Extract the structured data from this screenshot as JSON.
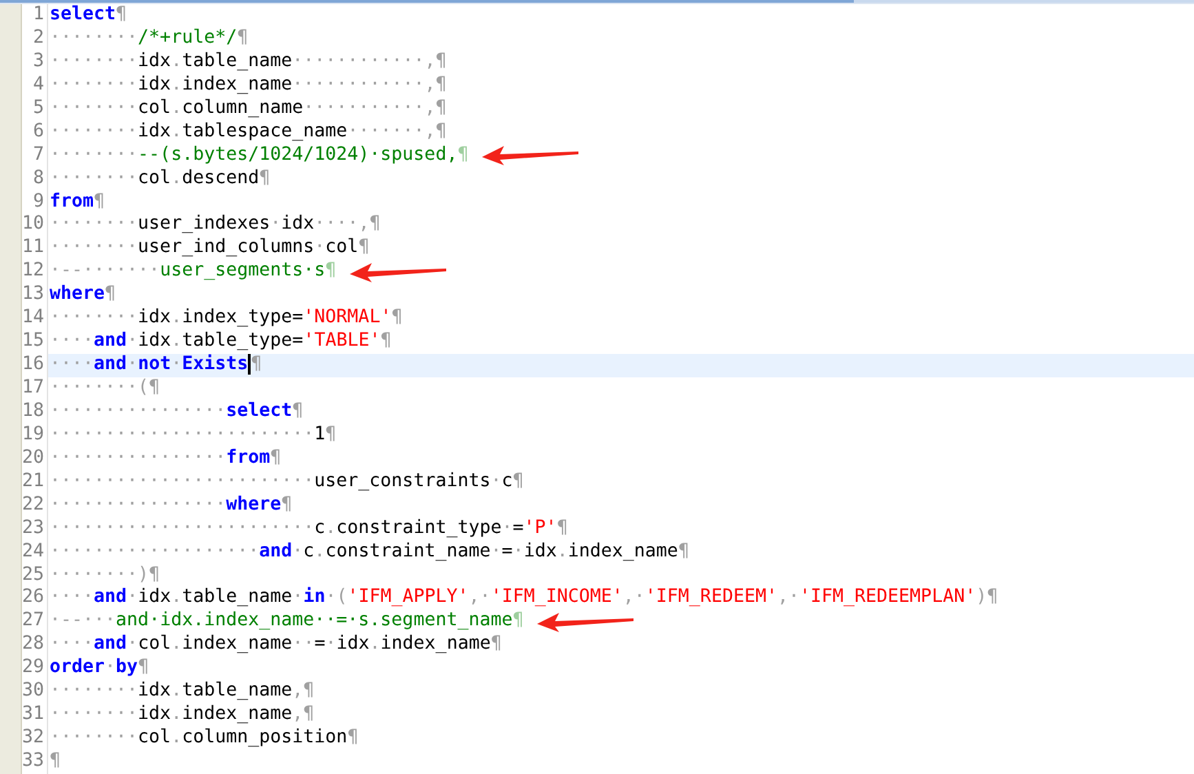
{
  "editor": {
    "lines": [
      {
        "number": "1",
        "current": false,
        "cursor": false,
        "arrow": false,
        "tokens": [
          {
            "kind": "keyword",
            "text": "select"
          },
          {
            "kind": "mark",
            "text": "¶"
          }
        ]
      },
      {
        "number": "2",
        "current": false,
        "cursor": false,
        "arrow": false,
        "tokens": [
          {
            "kind": "mark",
            "text": "········"
          },
          {
            "kind": "comment",
            "text": "/*+rule*/"
          },
          {
            "kind": "mark",
            "text": "¶"
          }
        ]
      },
      {
        "number": "3",
        "current": false,
        "cursor": false,
        "arrow": false,
        "tokens": [
          {
            "kind": "mark",
            "text": "········"
          },
          {
            "kind": "ident",
            "text": "idx"
          },
          {
            "kind": "mark",
            "text": "."
          },
          {
            "kind": "ident",
            "text": "table_name"
          },
          {
            "kind": "mark",
            "text": "············,¶"
          }
        ]
      },
      {
        "number": "4",
        "current": false,
        "cursor": false,
        "arrow": false,
        "tokens": [
          {
            "kind": "mark",
            "text": "········"
          },
          {
            "kind": "ident",
            "text": "idx"
          },
          {
            "kind": "mark",
            "text": "."
          },
          {
            "kind": "ident",
            "text": "index_name"
          },
          {
            "kind": "mark",
            "text": "············,¶"
          }
        ]
      },
      {
        "number": "5",
        "current": false,
        "cursor": false,
        "arrow": false,
        "tokens": [
          {
            "kind": "mark",
            "text": "········"
          },
          {
            "kind": "ident",
            "text": "col"
          },
          {
            "kind": "mark",
            "text": "."
          },
          {
            "kind": "ident",
            "text": "column_name"
          },
          {
            "kind": "mark",
            "text": "···········,¶"
          }
        ]
      },
      {
        "number": "6",
        "current": false,
        "cursor": false,
        "arrow": false,
        "tokens": [
          {
            "kind": "mark",
            "text": "········"
          },
          {
            "kind": "ident",
            "text": "idx"
          },
          {
            "kind": "mark",
            "text": "."
          },
          {
            "kind": "ident",
            "text": "tablespace_name"
          },
          {
            "kind": "mark",
            "text": "·······,¶"
          }
        ]
      },
      {
        "number": "7",
        "current": false,
        "cursor": false,
        "arrow": true,
        "tokens": [
          {
            "kind": "mark",
            "text": "········"
          },
          {
            "kind": "comment",
            "text": "--(s.bytes/1024/1024)·spused,"
          },
          {
            "kind": "comment-mark",
            "text": "¶"
          }
        ]
      },
      {
        "number": "8",
        "current": false,
        "cursor": false,
        "arrow": false,
        "tokens": [
          {
            "kind": "mark",
            "text": "········"
          },
          {
            "kind": "ident",
            "text": "col"
          },
          {
            "kind": "mark",
            "text": "."
          },
          {
            "kind": "ident",
            "text": "descend"
          },
          {
            "kind": "mark",
            "text": "¶"
          }
        ]
      },
      {
        "number": "9",
        "current": false,
        "cursor": false,
        "arrow": false,
        "tokens": [
          {
            "kind": "keyword",
            "text": "from"
          },
          {
            "kind": "mark",
            "text": "¶"
          }
        ]
      },
      {
        "number": "10",
        "current": false,
        "cursor": false,
        "arrow": false,
        "tokens": [
          {
            "kind": "mark",
            "text": "········"
          },
          {
            "kind": "ident",
            "text": "user_indexes"
          },
          {
            "kind": "mark",
            "text": "·"
          },
          {
            "kind": "ident",
            "text": "idx"
          },
          {
            "kind": "mark",
            "text": "····,¶"
          }
        ]
      },
      {
        "number": "11",
        "current": false,
        "cursor": false,
        "arrow": false,
        "tokens": [
          {
            "kind": "mark",
            "text": "········"
          },
          {
            "kind": "ident",
            "text": "user_ind_columns"
          },
          {
            "kind": "mark",
            "text": "·"
          },
          {
            "kind": "ident",
            "text": "col"
          },
          {
            "kind": "mark",
            "text": "¶"
          }
        ]
      },
      {
        "number": "12",
        "current": false,
        "cursor": false,
        "arrow": true,
        "tokens": [
          {
            "kind": "mark",
            "text": "·--·······"
          },
          {
            "kind": "comment",
            "text": "user_segments·s"
          },
          {
            "kind": "comment-mark",
            "text": "¶"
          }
        ]
      },
      {
        "number": "13",
        "current": false,
        "cursor": false,
        "arrow": false,
        "tokens": [
          {
            "kind": "keyword",
            "text": "where"
          },
          {
            "kind": "mark",
            "text": "¶"
          }
        ]
      },
      {
        "number": "14",
        "current": false,
        "cursor": false,
        "arrow": false,
        "tokens": [
          {
            "kind": "mark",
            "text": "········"
          },
          {
            "kind": "ident",
            "text": "idx"
          },
          {
            "kind": "mark",
            "text": "."
          },
          {
            "kind": "ident",
            "text": "index_type="
          },
          {
            "kind": "string",
            "text": "'NORMAL'"
          },
          {
            "kind": "mark",
            "text": "¶"
          }
        ]
      },
      {
        "number": "15",
        "current": false,
        "cursor": false,
        "arrow": false,
        "tokens": [
          {
            "kind": "mark",
            "text": "····"
          },
          {
            "kind": "keyword",
            "text": "and"
          },
          {
            "kind": "mark",
            "text": "·"
          },
          {
            "kind": "ident",
            "text": "idx"
          },
          {
            "kind": "mark",
            "text": "."
          },
          {
            "kind": "ident",
            "text": "table_type="
          },
          {
            "kind": "string",
            "text": "'TABLE'"
          },
          {
            "kind": "mark",
            "text": "¶"
          }
        ]
      },
      {
        "number": "16",
        "current": true,
        "cursor": true,
        "arrow": false,
        "tokens": [
          {
            "kind": "mark",
            "text": "····"
          },
          {
            "kind": "keyword",
            "text": "and"
          },
          {
            "kind": "mark",
            "text": "·"
          },
          {
            "kind": "keyword",
            "text": "not"
          },
          {
            "kind": "mark",
            "text": "·"
          },
          {
            "kind": "keyword",
            "text": "Exists"
          },
          {
            "kind": "mark",
            "text": "¶"
          }
        ]
      },
      {
        "number": "17",
        "current": false,
        "cursor": false,
        "arrow": false,
        "tokens": [
          {
            "kind": "mark",
            "text": "········(¶"
          }
        ]
      },
      {
        "number": "18",
        "current": false,
        "cursor": false,
        "arrow": false,
        "tokens": [
          {
            "kind": "mark",
            "text": "················"
          },
          {
            "kind": "keyword",
            "text": "select"
          },
          {
            "kind": "mark",
            "text": "¶"
          }
        ]
      },
      {
        "number": "19",
        "current": false,
        "cursor": false,
        "arrow": false,
        "tokens": [
          {
            "kind": "mark",
            "text": "························"
          },
          {
            "kind": "ident",
            "text": "1"
          },
          {
            "kind": "mark",
            "text": "¶"
          }
        ]
      },
      {
        "number": "20",
        "current": false,
        "cursor": false,
        "arrow": false,
        "tokens": [
          {
            "kind": "mark",
            "text": "················"
          },
          {
            "kind": "keyword",
            "text": "from"
          },
          {
            "kind": "mark",
            "text": "¶"
          }
        ]
      },
      {
        "number": "21",
        "current": false,
        "cursor": false,
        "arrow": false,
        "tokens": [
          {
            "kind": "mark",
            "text": "························"
          },
          {
            "kind": "ident",
            "text": "user_constraints"
          },
          {
            "kind": "mark",
            "text": "·"
          },
          {
            "kind": "ident",
            "text": "c"
          },
          {
            "kind": "mark",
            "text": "¶"
          }
        ]
      },
      {
        "number": "22",
        "current": false,
        "cursor": false,
        "arrow": false,
        "tokens": [
          {
            "kind": "mark",
            "text": "················"
          },
          {
            "kind": "keyword",
            "text": "where"
          },
          {
            "kind": "mark",
            "text": "¶"
          }
        ]
      },
      {
        "number": "23",
        "current": false,
        "cursor": false,
        "arrow": false,
        "tokens": [
          {
            "kind": "mark",
            "text": "························"
          },
          {
            "kind": "ident",
            "text": "c"
          },
          {
            "kind": "mark",
            "text": "."
          },
          {
            "kind": "ident",
            "text": "constraint_type"
          },
          {
            "kind": "mark",
            "text": "·"
          },
          {
            "kind": "ident",
            "text": "="
          },
          {
            "kind": "string",
            "text": "'P'"
          },
          {
            "kind": "mark",
            "text": "¶"
          }
        ]
      },
      {
        "number": "24",
        "current": false,
        "cursor": false,
        "arrow": false,
        "tokens": [
          {
            "kind": "mark",
            "text": "···················"
          },
          {
            "kind": "keyword",
            "text": "and"
          },
          {
            "kind": "mark",
            "text": "·"
          },
          {
            "kind": "ident",
            "text": "c"
          },
          {
            "kind": "mark",
            "text": "."
          },
          {
            "kind": "ident",
            "text": "constraint_name"
          },
          {
            "kind": "mark",
            "text": "·"
          },
          {
            "kind": "ident",
            "text": "="
          },
          {
            "kind": "mark",
            "text": "·"
          },
          {
            "kind": "ident",
            "text": "idx"
          },
          {
            "kind": "mark",
            "text": "."
          },
          {
            "kind": "ident",
            "text": "index_name"
          },
          {
            "kind": "mark",
            "text": "¶"
          }
        ]
      },
      {
        "number": "25",
        "current": false,
        "cursor": false,
        "arrow": false,
        "tokens": [
          {
            "kind": "mark",
            "text": "········)¶"
          }
        ]
      },
      {
        "number": "26",
        "current": false,
        "cursor": false,
        "arrow": false,
        "tokens": [
          {
            "kind": "mark",
            "text": "····"
          },
          {
            "kind": "keyword",
            "text": "and"
          },
          {
            "kind": "mark",
            "text": "·"
          },
          {
            "kind": "ident",
            "text": "idx"
          },
          {
            "kind": "mark",
            "text": "."
          },
          {
            "kind": "ident",
            "text": "table_name"
          },
          {
            "kind": "mark",
            "text": "·"
          },
          {
            "kind": "keyword",
            "text": "in"
          },
          {
            "kind": "mark",
            "text": "·("
          },
          {
            "kind": "string",
            "text": "'IFM_APPLY'"
          },
          {
            "kind": "mark",
            "text": ",·"
          },
          {
            "kind": "string",
            "text": "'IFM_INCOME'"
          },
          {
            "kind": "mark",
            "text": ",·"
          },
          {
            "kind": "string",
            "text": "'IFM_REDEEM'"
          },
          {
            "kind": "mark",
            "text": ",·"
          },
          {
            "kind": "string",
            "text": "'IFM_REDEEMPLAN'"
          },
          {
            "kind": "mark",
            "text": ")¶"
          }
        ]
      },
      {
        "number": "27",
        "current": false,
        "cursor": false,
        "arrow": true,
        "tokens": [
          {
            "kind": "mark",
            "text": "·--···"
          },
          {
            "kind": "comment",
            "text": "and·idx.index_name··=·s.segment_name"
          },
          {
            "kind": "comment-mark",
            "text": "¶"
          }
        ]
      },
      {
        "number": "28",
        "current": false,
        "cursor": false,
        "arrow": false,
        "tokens": [
          {
            "kind": "mark",
            "text": "····"
          },
          {
            "kind": "keyword",
            "text": "and"
          },
          {
            "kind": "mark",
            "text": "·"
          },
          {
            "kind": "ident",
            "text": "col"
          },
          {
            "kind": "mark",
            "text": "."
          },
          {
            "kind": "ident",
            "text": "index_name"
          },
          {
            "kind": "mark",
            "text": "··"
          },
          {
            "kind": "ident",
            "text": "="
          },
          {
            "kind": "mark",
            "text": "·"
          },
          {
            "kind": "ident",
            "text": "idx"
          },
          {
            "kind": "mark",
            "text": "."
          },
          {
            "kind": "ident",
            "text": "index_name"
          },
          {
            "kind": "mark",
            "text": "¶"
          }
        ]
      },
      {
        "number": "29",
        "current": false,
        "cursor": false,
        "arrow": false,
        "tokens": [
          {
            "kind": "keyword",
            "text": "order"
          },
          {
            "kind": "mark",
            "text": "·"
          },
          {
            "kind": "keyword",
            "text": "by"
          },
          {
            "kind": "mark",
            "text": "¶"
          }
        ]
      },
      {
        "number": "30",
        "current": false,
        "cursor": false,
        "arrow": false,
        "tokens": [
          {
            "kind": "mark",
            "text": "········"
          },
          {
            "kind": "ident",
            "text": "idx"
          },
          {
            "kind": "mark",
            "text": "."
          },
          {
            "kind": "ident",
            "text": "table_name"
          },
          {
            "kind": "mark",
            "text": ",¶"
          }
        ]
      },
      {
        "number": "31",
        "current": false,
        "cursor": false,
        "arrow": false,
        "tokens": [
          {
            "kind": "mark",
            "text": "········"
          },
          {
            "kind": "ident",
            "text": "idx"
          },
          {
            "kind": "mark",
            "text": "."
          },
          {
            "kind": "ident",
            "text": "index_name"
          },
          {
            "kind": "mark",
            "text": ",¶"
          }
        ]
      },
      {
        "number": "32",
        "current": false,
        "cursor": false,
        "arrow": false,
        "tokens": [
          {
            "kind": "mark",
            "text": "········"
          },
          {
            "kind": "ident",
            "text": "col"
          },
          {
            "kind": "mark",
            "text": "."
          },
          {
            "kind": "ident",
            "text": "column_position"
          },
          {
            "kind": "mark",
            "text": "¶"
          }
        ]
      },
      {
        "number": "33",
        "current": false,
        "cursor": false,
        "arrow": false,
        "tokens": [
          {
            "kind": "mark",
            "text": "¶"
          }
        ]
      }
    ]
  }
}
